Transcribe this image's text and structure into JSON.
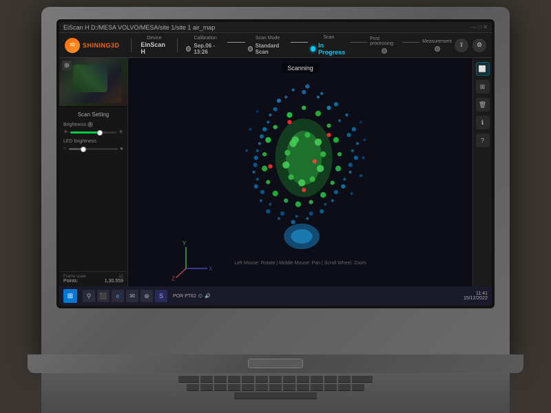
{
  "titlebar": {
    "path": "EiScan H  D:/MESA VOLVO/MESA/site 1/site 1 air_map"
  },
  "nav": {
    "logo": "3D",
    "brand": "SHINING3D",
    "device_label": "Device",
    "device_value": "EinScan H",
    "calibration_label": "Calibration",
    "calibration_value": "Sep.06 - 13:26",
    "scan_mode_label": "Scan Mode",
    "scan_mode_value": "Standard Scan",
    "scan_label": "Scan",
    "scan_value": "In Progress",
    "post_label": "Post processing",
    "measurement_label": "Measurement"
  },
  "sidebar": {
    "scan_settings_title": "Scan Setting",
    "brightness_label": "Brightness",
    "led_label": "LED brightness",
    "brightness_value": 65,
    "led_value": 30,
    "frame_label": "Frame scale",
    "frame_count": "12",
    "points_label": "Points:",
    "points_value": "1,30,559"
  },
  "viewport": {
    "scanning_label": "Scanning",
    "hint": "Left Mouse: Rotate | Middle Mouse: Pan | Scroll Wheel: Zoom"
  },
  "taskbar": {
    "time": "11:41",
    "date": "15/12/2022",
    "sys_label": "POR PT62"
  }
}
